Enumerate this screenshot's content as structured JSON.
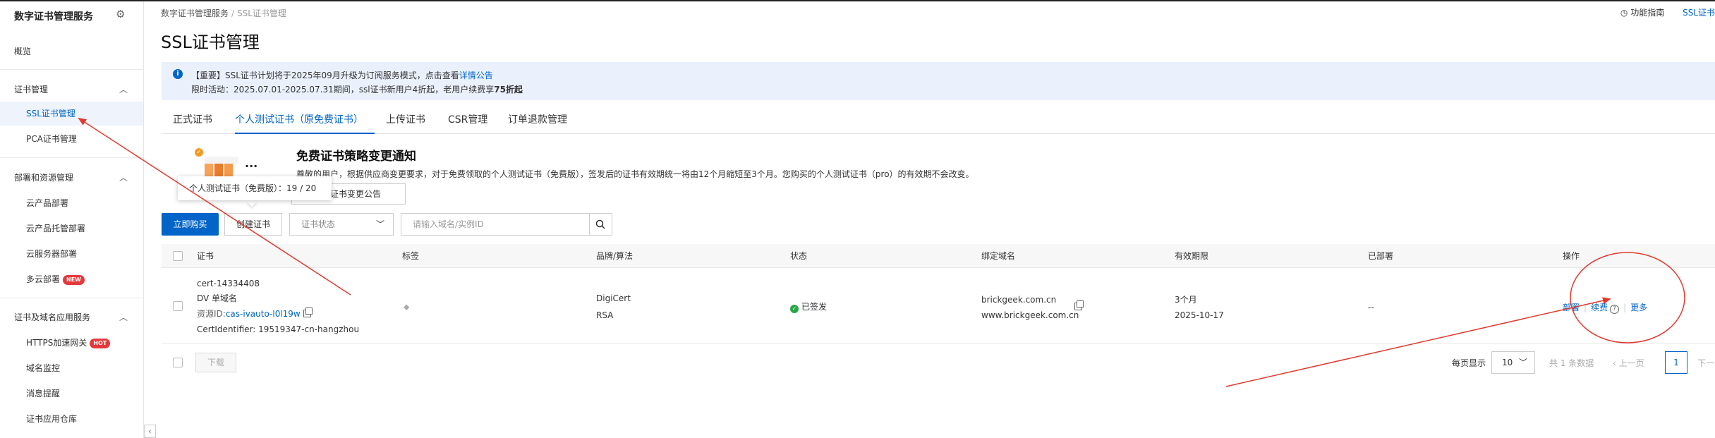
{
  "app": {
    "title": "数字证书管理服务"
  },
  "sidebar": {
    "items": [
      {
        "label": "概览"
      },
      {
        "label": "证书管理"
      },
      {
        "label": "SSL证书管理"
      },
      {
        "label": "PCA证书管理"
      },
      {
        "label": "部署和资源管理"
      },
      {
        "label": "云产品部署"
      },
      {
        "label": "云产品托管部署"
      },
      {
        "label": "云服务器部署"
      },
      {
        "label": "多云部署",
        "badge": "NEW"
      },
      {
        "label": "证书及域名应用服务"
      },
      {
        "label": "HTTPS加速网关",
        "badge": "HOT"
      },
      {
        "label": "域名监控"
      },
      {
        "label": "消息提醒"
      },
      {
        "label": "证书应用仓库"
      }
    ]
  },
  "breadcrumb": {
    "root": "数字证书管理服务",
    "sep": "/",
    "current": "SSL证书管理"
  },
  "header": {
    "guide": "功能指南",
    "right_link": "SSL证书"
  },
  "page": {
    "title": "SSL证书管理"
  },
  "notice": {
    "l1_prefix": "【重要】SSL证书计划将于2025年09月升级为订阅服务模式，点击查看",
    "l1_link": "详情公告",
    "l2_prefix": "限时活动：2025.07.01-2025.07.31期间，ssl证书新用户4折起，老用户续费享",
    "l2_bold": "75折起"
  },
  "tabs": [
    {
      "label": "正式证书"
    },
    {
      "label": "个人测试证书（原免费证书）"
    },
    {
      "label": "上传证书"
    },
    {
      "label": "CSR管理"
    },
    {
      "label": "订单退款管理"
    }
  ],
  "promo": {
    "dots": "...",
    "title": "免费证书策略变更通知",
    "text": "尊敬的用户，根据供应商变更要求，对于免费领取的个人测试证书（免费版），签发后的证书有效期统一将由12个月缩短至3个月。您购买的个人测试证书（pro）的有效期不会改变。",
    "button": "免费证书变更公告"
  },
  "tooltip": {
    "text": "个人测试证书（免费版）：19 / 20"
  },
  "toolbar": {
    "buy": "立即购买",
    "create": "创建证书",
    "status_placeholder": "证书状态",
    "search_placeholder": "请输入域名/实例ID"
  },
  "table": {
    "headers": [
      "证书",
      "标签",
      "品牌/算法",
      "状态",
      "绑定域名",
      "有效期限",
      "已部署",
      "操作"
    ],
    "row": {
      "cert_name": "cert-14334408",
      "cert_type": "DV 单域名",
      "resource_prefix": "资源ID:",
      "resource_id": "cas-ivauto-l0l19w",
      "identifier": "CertIdentifier: 19519347-cn-hangzhou",
      "brand": "DigiCert",
      "algo": "RSA",
      "status": "已签发",
      "domain1": "brickgeek.com.cn",
      "domain2": "www.brickgeek.com.cn",
      "validity": "3个月",
      "expire": "2025-10-17",
      "deployed": "--",
      "op_deploy": "部署",
      "op_renew": "续费",
      "op_more": "更多"
    }
  },
  "footer": {
    "download": "下载",
    "per_page_label": "每页显示",
    "per_page": "10",
    "total": "共 1 条数据",
    "prev": "上一页",
    "page": "1",
    "next": "下一"
  },
  "colors": {
    "accent": "#0064c8",
    "annotation": "#e03a2f",
    "success": "#2aa745"
  }
}
